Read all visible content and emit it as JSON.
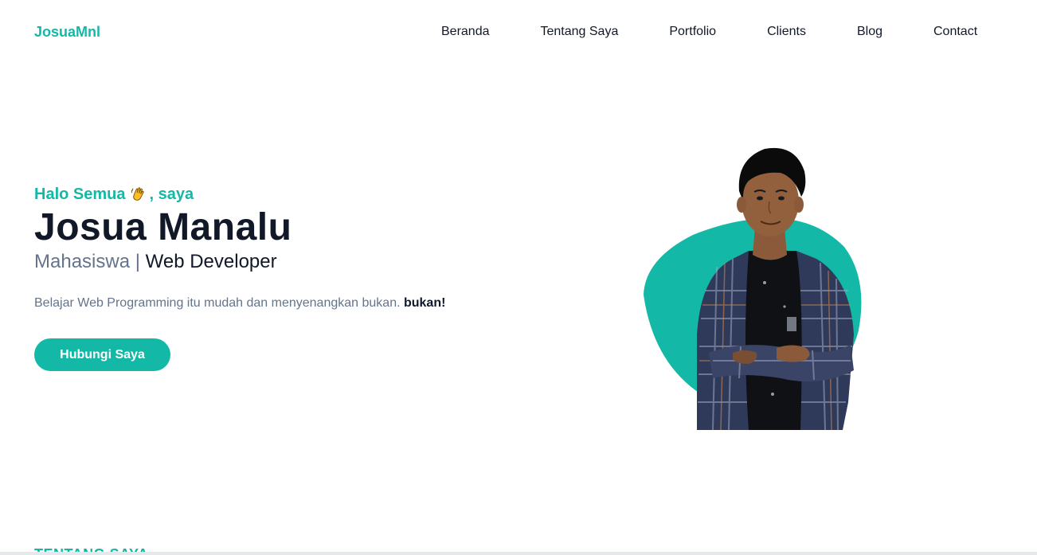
{
  "navbar": {
    "brand": "JosuaMnl",
    "links": [
      "Beranda",
      "Tentang Saya",
      "Portfolio",
      "Clients",
      "Blog",
      "Contact"
    ]
  },
  "hero": {
    "greeting_prefix": "Halo Semua",
    "greeting_icon": "waving-hand-icon",
    "greeting_suffix": ", saya",
    "name": "Josua Manalu",
    "role_muted": "Mahasiswa |",
    "role_main": "Web Developer",
    "tagline": "Belajar Web Programming itu mudah dan menyenangkan bukan.",
    "tagline_bold": "bukan!",
    "cta_label": "Hubungi Saya"
  },
  "next_section": {
    "title": "TENTANG SAYA"
  },
  "colors": {
    "accent": "#14b8a6",
    "text": "#111827",
    "muted": "#64748b"
  }
}
